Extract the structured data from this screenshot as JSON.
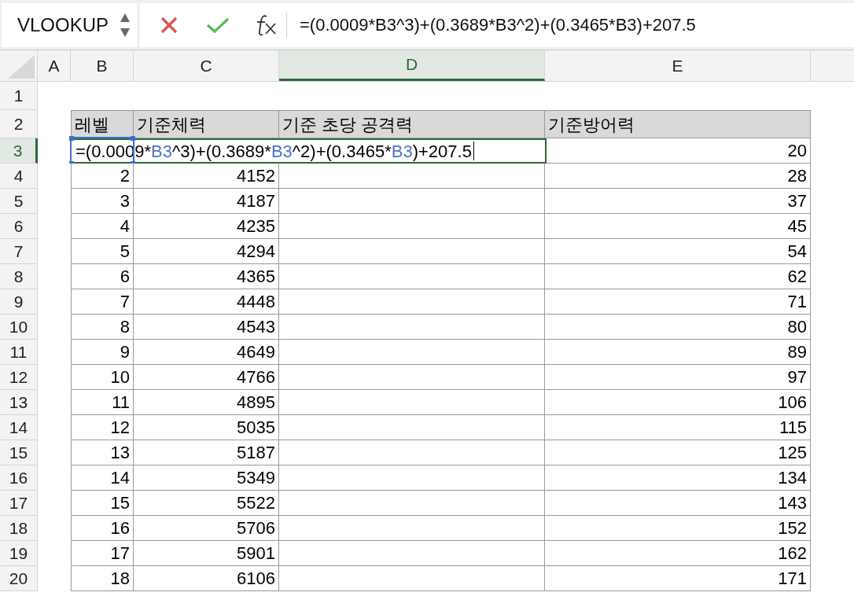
{
  "name_box": {
    "value": "VLOOKUP"
  },
  "formula_bar": {
    "formula": "=(0.0009*B3^3)+(0.3689*B3^2)+(0.3465*B3)+207.5"
  },
  "columns": [
    {
      "label": "A",
      "selected": false
    },
    {
      "label": "B",
      "selected": false
    },
    {
      "label": "C",
      "selected": false
    },
    {
      "label": "D",
      "selected": true
    },
    {
      "label": "E",
      "selected": false
    }
  ],
  "rows": [
    {
      "label": "1",
      "selected": false,
      "kind": "blank"
    },
    {
      "label": "2",
      "selected": false,
      "kind": "header",
      "cells": [
        "레벨",
        "기준체력",
        "기준 초당 공격력",
        "기준방어력"
      ]
    },
    {
      "label": "3",
      "selected": true,
      "kind": "editing",
      "e": "20",
      "editor": [
        {
          "text": "=(0.0009*",
          "kind": "plain"
        },
        {
          "text": "B3",
          "kind": "ref"
        },
        {
          "text": "^3)+(0.3689*",
          "kind": "plain"
        },
        {
          "text": "B3",
          "kind": "ref"
        },
        {
          "text": "^2)+(0.3465*",
          "kind": "plain"
        },
        {
          "text": "B3",
          "kind": "ref"
        },
        {
          "text": ")+207.5",
          "kind": "plain"
        }
      ]
    },
    {
      "label": "4",
      "selected": false,
      "kind": "data",
      "b": "2",
      "c": "4152",
      "e": "28"
    },
    {
      "label": "5",
      "selected": false,
      "kind": "data",
      "b": "3",
      "c": "4187",
      "e": "37"
    },
    {
      "label": "6",
      "selected": false,
      "kind": "data",
      "b": "4",
      "c": "4235",
      "e": "45"
    },
    {
      "label": "7",
      "selected": false,
      "kind": "data",
      "b": "5",
      "c": "4294",
      "e": "54"
    },
    {
      "label": "8",
      "selected": false,
      "kind": "data",
      "b": "6",
      "c": "4365",
      "e": "62"
    },
    {
      "label": "9",
      "selected": false,
      "kind": "data",
      "b": "7",
      "c": "4448",
      "e": "71"
    },
    {
      "label": "10",
      "selected": false,
      "kind": "data",
      "b": "8",
      "c": "4543",
      "e": "80"
    },
    {
      "label": "11",
      "selected": false,
      "kind": "data",
      "b": "9",
      "c": "4649",
      "e": "89"
    },
    {
      "label": "12",
      "selected": false,
      "kind": "data",
      "b": "10",
      "c": "4766",
      "e": "97"
    },
    {
      "label": "13",
      "selected": false,
      "kind": "data",
      "b": "11",
      "c": "4895",
      "e": "106"
    },
    {
      "label": "14",
      "selected": false,
      "kind": "data",
      "b": "12",
      "c": "5035",
      "e": "115"
    },
    {
      "label": "15",
      "selected": false,
      "kind": "data",
      "b": "13",
      "c": "5187",
      "e": "125"
    },
    {
      "label": "16",
      "selected": false,
      "kind": "data",
      "b": "14",
      "c": "5349",
      "e": "134"
    },
    {
      "label": "17",
      "selected": false,
      "kind": "data",
      "b": "15",
      "c": "5522",
      "e": "143"
    },
    {
      "label": "18",
      "selected": false,
      "kind": "data",
      "b": "16",
      "c": "5706",
      "e": "152"
    },
    {
      "label": "19",
      "selected": false,
      "kind": "data",
      "b": "17",
      "c": "5901",
      "e": "162"
    },
    {
      "label": "20",
      "selected": false,
      "kind": "data",
      "b": "18",
      "c": "6106",
      "e": "171"
    }
  ]
}
